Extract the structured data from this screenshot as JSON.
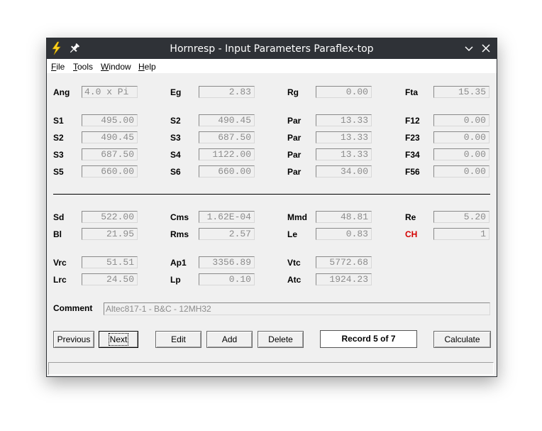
{
  "window": {
    "title": "Hornresp - Input Parameters Paraflex-top"
  },
  "icons": {
    "app": "lightning-icon",
    "pin": "pin-icon",
    "minimize": "chevron-down-icon",
    "close": "close-icon"
  },
  "menu": [
    "File",
    "Tools",
    "Window",
    "Help"
  ],
  "params": {
    "row1": [
      {
        "label": "Ang",
        "value": "4.0 x Pi"
      },
      {
        "label": "Eg",
        "value": "2.83"
      },
      {
        "label": "Rg",
        "value": "0.00"
      },
      {
        "label": "Fta",
        "value": "15.35"
      }
    ],
    "row2": [
      {
        "label": "S1",
        "value": "495.00"
      },
      {
        "label": "S2",
        "value": "490.45"
      },
      {
        "label": "Par",
        "value": "13.33"
      },
      {
        "label": "F12",
        "value": "0.00"
      }
    ],
    "row3": [
      {
        "label": "S2",
        "value": "490.45"
      },
      {
        "label": "S3",
        "value": "687.50"
      },
      {
        "label": "Par",
        "value": "13.33"
      },
      {
        "label": "F23",
        "value": "0.00"
      }
    ],
    "row4": [
      {
        "label": "S3",
        "value": "687.50"
      },
      {
        "label": "S4",
        "value": "1122.00"
      },
      {
        "label": "Par",
        "value": "13.33"
      },
      {
        "label": "F34",
        "value": "0.00"
      }
    ],
    "row5": [
      {
        "label": "S5",
        "value": "660.00"
      },
      {
        "label": "S6",
        "value": "660.00"
      },
      {
        "label": "Par",
        "value": "34.00"
      },
      {
        "label": "F56",
        "value": "0.00"
      }
    ],
    "row6": [
      {
        "label": "Sd",
        "value": "522.00"
      },
      {
        "label": "Cms",
        "value": "1.62E-04"
      },
      {
        "label": "Mmd",
        "value": "48.81"
      },
      {
        "label": "Re",
        "value": "5.20"
      }
    ],
    "row7": [
      {
        "label": "Bl",
        "value": "21.95"
      },
      {
        "label": "Rms",
        "value": "2.57"
      },
      {
        "label": "Le",
        "value": "0.83"
      },
      {
        "label": "CH",
        "value": "1"
      }
    ],
    "row8": [
      {
        "label": "Vrc",
        "value": "51.51"
      },
      {
        "label": "Ap1",
        "value": "3356.89"
      },
      {
        "label": "Vtc",
        "value": "5772.68"
      }
    ],
    "row9": [
      {
        "label": "Lrc",
        "value": "24.50"
      },
      {
        "label": "Lp",
        "value": "0.10"
      },
      {
        "label": "Atc",
        "value": "1924.23"
      }
    ]
  },
  "comment": {
    "label": "Comment",
    "value": "Altec817-1 - B&C - 12MH32"
  },
  "buttons": {
    "previous": "Previous",
    "next": "Next",
    "edit": "Edit",
    "add": "Add",
    "delete": "Delete",
    "calculate": "Calculate"
  },
  "record": "Record 5 of 7",
  "colors": {
    "titlebar": "#2f3237",
    "ch_label": "#d40000",
    "field_text": "#8c8c8c"
  }
}
